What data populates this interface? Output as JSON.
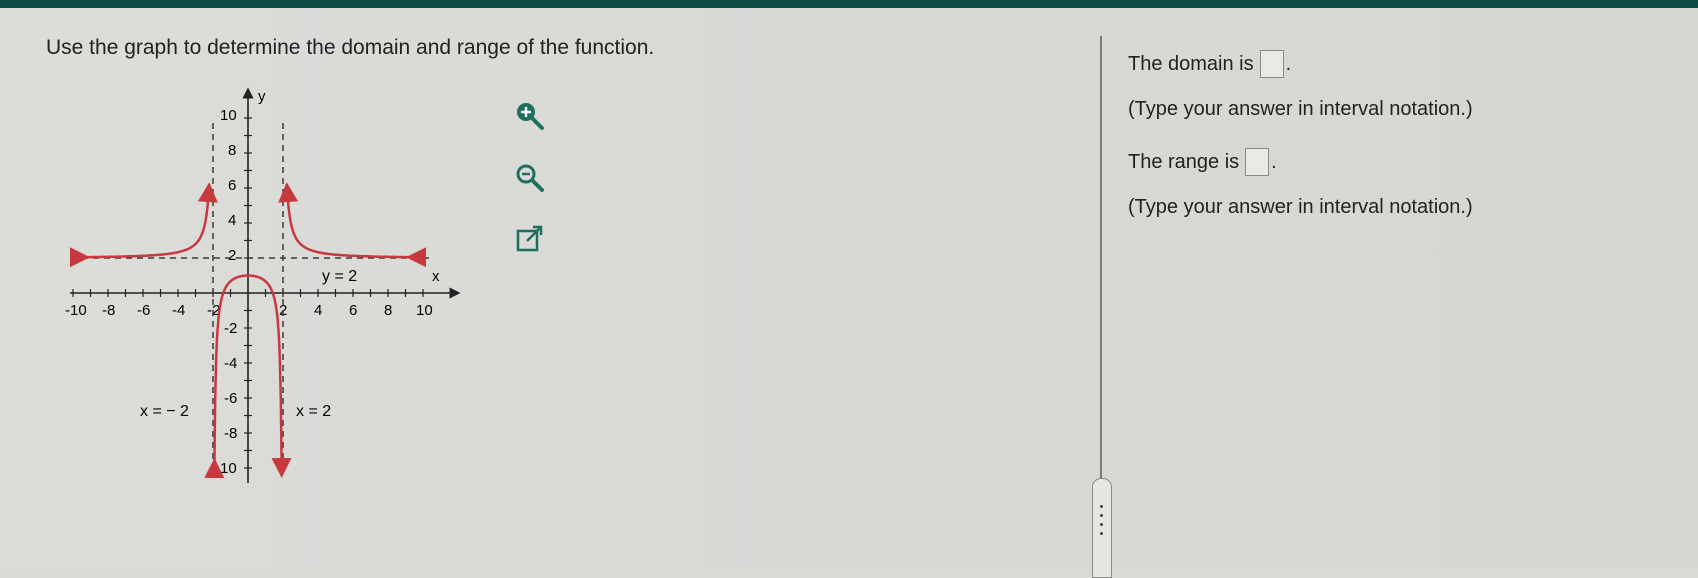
{
  "question": {
    "prompt": "Use the graph to determine the domain and range of the function."
  },
  "graph": {
    "axis_labels": {
      "x": "x",
      "y": "y"
    },
    "x_ticks": [
      "-10",
      "-8",
      "-6",
      "-4",
      "-2",
      "2",
      "4",
      "6",
      "8",
      "10"
    ],
    "y_ticks_pos": [
      "10",
      "8",
      "6",
      "4",
      "2"
    ],
    "y_ticks_neg": [
      "-2",
      "-4",
      "-6",
      "-8",
      "-10"
    ],
    "asymptote_labels": {
      "horizontal": "y = 2",
      "left_vertical": "x = − 2",
      "right_vertical": "x = 2"
    },
    "curve_color": "#c8393e",
    "asymptote_color": "#3a3a3a"
  },
  "tools": {
    "zoom_in": "zoom-in-icon",
    "zoom_out": "zoom-out-icon",
    "popout": "external-link-icon"
  },
  "answers": {
    "domain_label": "The domain is",
    "domain_hint": "(Type your answer in interval notation.)",
    "range_label": "The range is",
    "range_hint": "(Type your answer in interval notation.)",
    "domain_value": "",
    "range_value": ""
  },
  "colors": {
    "topbar": "#0f4d44",
    "tool_icon": "#1e6f5f"
  }
}
